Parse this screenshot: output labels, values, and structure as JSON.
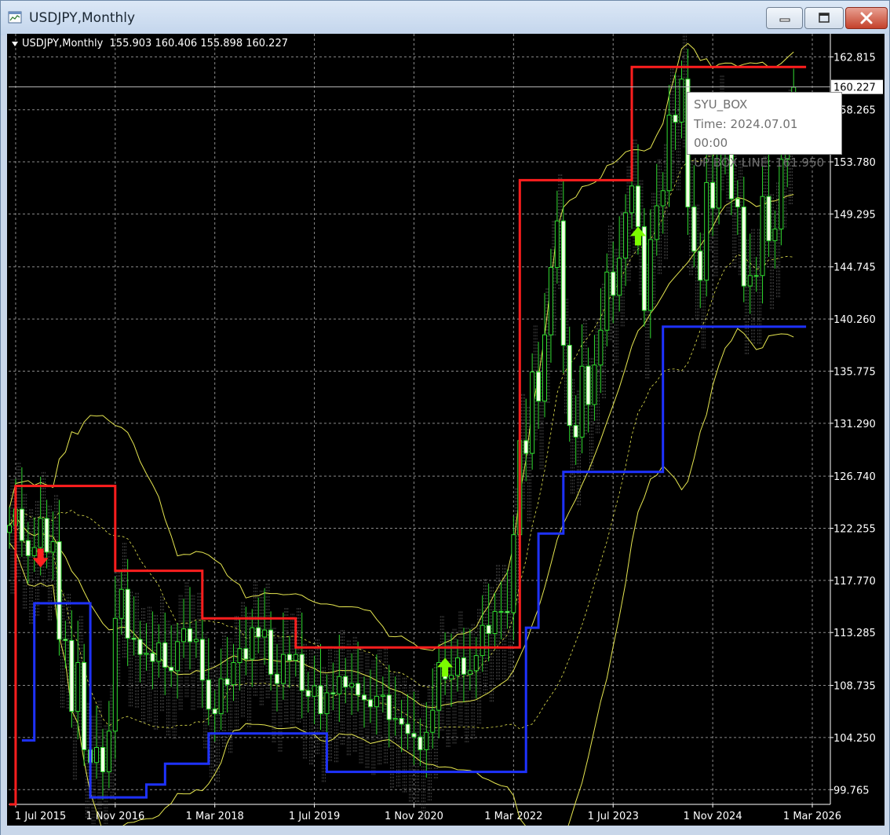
{
  "window": {
    "title": "USDJPY,Monthly",
    "buttons": {
      "minimize": "minimize-icon",
      "maximize": "maximize-icon",
      "close": "close-icon"
    }
  },
  "chart_header": {
    "text": "USDJPY,Monthly  155.903 160.406 155.898 160.227"
  },
  "tooltip": {
    "name": "SYU_BOX",
    "time": "Time: 2024.07.01 00:00",
    "value": "UP BOX LINE: 161.950"
  },
  "colors": {
    "background": "#000000",
    "grid": "#8a8a8a",
    "up_box_line": "#ff1e1e",
    "down_box_line": "#1e32ff",
    "bands": "#e6e650",
    "candles": "#32dc32",
    "arrow_up": "#7cfc00",
    "arrow_down": "#ff2020"
  },
  "chart_data": {
    "type": "candlestick",
    "symbol": "USDJPY",
    "timeframe": "Monthly",
    "last_price": "160.227",
    "ohlc_last": {
      "open": 155.903,
      "high": 160.406,
      "low": 155.898,
      "close": 160.227
    },
    "y_ticks": [
      "162.815",
      "158.265",
      "153.780",
      "149.295",
      "144.745",
      "140.260",
      "135.775",
      "131.290",
      "126.740",
      "122.255",
      "117.770",
      "113.285",
      "108.735",
      "104.250",
      "99.765"
    ],
    "x_ticks": [
      "1 Jul 2015",
      "1 Nov 2016",
      "1 Mar 2018",
      "1 Jul 2019",
      "1 Nov 2020",
      "1 Mar 2022",
      "1 Jul 2023",
      "1 Nov 2024",
      "1 Mar 2026"
    ],
    "ylim": [
      98.5,
      164.8
    ],
    "xlim_months": [
      "2015-06",
      "2026-03"
    ],
    "close_series": [
      {
        "m": "2015-06",
        "v": 122.5
      },
      {
        "m": "2015-07",
        "v": 123.9
      },
      {
        "m": "2015-08",
        "v": 121.2
      },
      {
        "m": "2015-09",
        "v": 119.9
      },
      {
        "m": "2015-10",
        "v": 120.6
      },
      {
        "m": "2015-11",
        "v": 123.1
      },
      {
        "m": "2015-12",
        "v": 120.2
      },
      {
        "m": "2016-01",
        "v": 121.1
      },
      {
        "m": "2016-02",
        "v": 112.7
      },
      {
        "m": "2016-03",
        "v": 112.6
      },
      {
        "m": "2016-04",
        "v": 106.5
      },
      {
        "m": "2016-05",
        "v": 110.7
      },
      {
        "m": "2016-06",
        "v": 103.2
      },
      {
        "m": "2016-07",
        "v": 102.1
      },
      {
        "m": "2016-08",
        "v": 103.4
      },
      {
        "m": "2016-09",
        "v": 101.3
      },
      {
        "m": "2016-10",
        "v": 104.8
      },
      {
        "m": "2016-11",
        "v": 114.5
      },
      {
        "m": "2016-12",
        "v": 117.0
      },
      {
        "m": "2017-01",
        "v": 112.8
      },
      {
        "m": "2017-02",
        "v": 112.7
      },
      {
        "m": "2017-03",
        "v": 111.4
      },
      {
        "m": "2017-04",
        "v": 111.5
      },
      {
        "m": "2017-05",
        "v": 110.8
      },
      {
        "m": "2017-06",
        "v": 112.4
      },
      {
        "m": "2017-07",
        "v": 110.3
      },
      {
        "m": "2017-08",
        "v": 110.0
      },
      {
        "m": "2017-09",
        "v": 112.5
      },
      {
        "m": "2017-10",
        "v": 113.6
      },
      {
        "m": "2017-11",
        "v": 112.5
      },
      {
        "m": "2017-12",
        "v": 112.7
      },
      {
        "m": "2018-01",
        "v": 109.2
      },
      {
        "m": "2018-02",
        "v": 106.7
      },
      {
        "m": "2018-03",
        "v": 106.3
      },
      {
        "m": "2018-04",
        "v": 109.3
      },
      {
        "m": "2018-05",
        "v": 108.8
      },
      {
        "m": "2018-06",
        "v": 110.7
      },
      {
        "m": "2018-07",
        "v": 111.9
      },
      {
        "m": "2018-08",
        "v": 111.0
      },
      {
        "m": "2018-09",
        "v": 113.7
      },
      {
        "m": "2018-10",
        "v": 112.9
      },
      {
        "m": "2018-11",
        "v": 113.5
      },
      {
        "m": "2018-12",
        "v": 109.7
      },
      {
        "m": "2019-01",
        "v": 108.9
      },
      {
        "m": "2019-02",
        "v": 111.4
      },
      {
        "m": "2019-03",
        "v": 110.9
      },
      {
        "m": "2019-04",
        "v": 111.4
      },
      {
        "m": "2019-05",
        "v": 108.3
      },
      {
        "m": "2019-06",
        "v": 107.8
      },
      {
        "m": "2019-07",
        "v": 108.7
      },
      {
        "m": "2019-08",
        "v": 106.3
      },
      {
        "m": "2019-09",
        "v": 108.1
      },
      {
        "m": "2019-10",
        "v": 108.0
      },
      {
        "m": "2019-11",
        "v": 109.5
      },
      {
        "m": "2019-12",
        "v": 108.6
      },
      {
        "m": "2020-01",
        "v": 108.9
      },
      {
        "m": "2020-02",
        "v": 107.9
      },
      {
        "m": "2020-03",
        "v": 107.5
      },
      {
        "m": "2020-04",
        "v": 106.9
      },
      {
        "m": "2020-05",
        "v": 107.8
      },
      {
        "m": "2020-06",
        "v": 107.9
      },
      {
        "m": "2020-07",
        "v": 105.8
      },
      {
        "m": "2020-08",
        "v": 105.9
      },
      {
        "m": "2020-09",
        "v": 105.4
      },
      {
        "m": "2020-10",
        "v": 104.6
      },
      {
        "m": "2020-11",
        "v": 104.3
      },
      {
        "m": "2020-12",
        "v": 103.2
      },
      {
        "m": "2021-01",
        "v": 104.7
      },
      {
        "m": "2021-02",
        "v": 106.6
      },
      {
        "m": "2021-03",
        "v": 110.7
      },
      {
        "m": "2021-04",
        "v": 109.3
      },
      {
        "m": "2021-05",
        "v": 109.6
      },
      {
        "m": "2021-06",
        "v": 111.1
      },
      {
        "m": "2021-07",
        "v": 109.7
      },
      {
        "m": "2021-08",
        "v": 110.0
      },
      {
        "m": "2021-09",
        "v": 111.3
      },
      {
        "m": "2021-10",
        "v": 113.9
      },
      {
        "m": "2021-11",
        "v": 113.2
      },
      {
        "m": "2021-12",
        "v": 115.1
      },
      {
        "m": "2022-01",
        "v": 115.1
      },
      {
        "m": "2022-02",
        "v": 115.0
      },
      {
        "m": "2022-03",
        "v": 121.7
      },
      {
        "m": "2022-04",
        "v": 129.8
      },
      {
        "m": "2022-05",
        "v": 128.7
      },
      {
        "m": "2022-06",
        "v": 135.7
      },
      {
        "m": "2022-07",
        "v": 133.2
      },
      {
        "m": "2022-08",
        "v": 138.9
      },
      {
        "m": "2022-09",
        "v": 144.7
      },
      {
        "m": "2022-10",
        "v": 148.7
      },
      {
        "m": "2022-11",
        "v": 138.0
      },
      {
        "m": "2022-12",
        "v": 131.1
      },
      {
        "m": "2023-01",
        "v": 130.1
      },
      {
        "m": "2023-02",
        "v": 136.2
      },
      {
        "m": "2023-03",
        "v": 132.9
      },
      {
        "m": "2023-04",
        "v": 136.3
      },
      {
        "m": "2023-05",
        "v": 139.3
      },
      {
        "m": "2023-06",
        "v": 144.3
      },
      {
        "m": "2023-07",
        "v": 142.3
      },
      {
        "m": "2023-08",
        "v": 145.5
      },
      {
        "m": "2023-09",
        "v": 149.4
      },
      {
        "m": "2023-10",
        "v": 151.7
      },
      {
        "m": "2023-11",
        "v": 148.2
      },
      {
        "m": "2023-12",
        "v": 141.0
      },
      {
        "m": "2024-01",
        "v": 147.1
      },
      {
        "m": "2024-02",
        "v": 150.0
      },
      {
        "m": "2024-03",
        "v": 151.3
      },
      {
        "m": "2024-04",
        "v": 157.8
      },
      {
        "m": "2024-05",
        "v": 157.2
      },
      {
        "m": "2024-06",
        "v": 160.9
      },
      {
        "m": "2024-07",
        "v": 149.9
      },
      {
        "m": "2024-08",
        "v": 146.1
      },
      {
        "m": "2024-09",
        "v": 143.6
      },
      {
        "m": "2024-10",
        "v": 152.0
      },
      {
        "m": "2024-11",
        "v": 149.8
      },
      {
        "m": "2024-12",
        "v": 157.2
      },
      {
        "m": "2025-01",
        "v": 155.1
      },
      {
        "m": "2025-02",
        "v": 150.6
      },
      {
        "m": "2025-03",
        "v": 149.9
      },
      {
        "m": "2025-04",
        "v": 143.1
      },
      {
        "m": "2025-05",
        "v": 144.0
      },
      {
        "m": "2025-06",
        "v": 144.0
      },
      {
        "m": "2025-07",
        "v": 150.8
      },
      {
        "m": "2025-08",
        "v": 147.0
      },
      {
        "m": "2025-09",
        "v": 148.0
      },
      {
        "m": "2025-10",
        "v": 154.0
      },
      {
        "m": "2025-11",
        "v": 156.0
      },
      {
        "m": "2025-12",
        "v": 160.2
      }
    ],
    "up_box_line": [
      {
        "from": "2015-06",
        "to": "2015-07",
        "v": 98.5
      },
      {
        "from": "2015-07",
        "to": "2016-11",
        "v": 125.9
      },
      {
        "from": "2016-11",
        "to": "2018-01",
        "v": 118.6
      },
      {
        "from": "2018-01",
        "to": "2019-02",
        "v": 114.5
      },
      {
        "from": "2019-02",
        "to": "2019-04",
        "v": 114.5
      },
      {
        "from": "2019-04",
        "to": "2022-04",
        "v": 112.0
      },
      {
        "from": "2022-04",
        "to": "2023-10",
        "v": 152.2
      },
      {
        "from": "2023-10",
        "to": "2026-02",
        "v": 161.95
      }
    ],
    "down_box_line": [
      {
        "from": "2015-08",
        "to": "2015-10",
        "v": 104.0
      },
      {
        "from": "2015-10",
        "to": "2016-07",
        "v": 115.8
      },
      {
        "from": "2016-07",
        "to": "2017-04",
        "v": 99.1
      },
      {
        "from": "2017-04",
        "to": "2017-07",
        "v": 100.2
      },
      {
        "from": "2017-07",
        "to": "2018-02",
        "v": 102.0
      },
      {
        "from": "2018-02",
        "to": "2019-09",
        "v": 104.6
      },
      {
        "from": "2019-09",
        "to": "2022-05",
        "v": 101.3
      },
      {
        "from": "2022-05",
        "to": "2022-07",
        "v": 113.7
      },
      {
        "from": "2022-07",
        "to": "2022-11",
        "v": 121.8
      },
      {
        "from": "2022-11",
        "to": "2023-04",
        "v": 127.1
      },
      {
        "from": "2023-04",
        "to": "2024-03",
        "v": 127.1
      },
      {
        "from": "2024-03",
        "to": "2026-02",
        "v": 139.6
      }
    ],
    "signal_arrows": [
      {
        "m": "2015-11",
        "dir": "down",
        "v": 119.7
      },
      {
        "m": "2021-04",
        "dir": "up",
        "v": 110.3
      },
      {
        "m": "2023-11",
        "dir": "up",
        "v": 147.4
      }
    ]
  }
}
